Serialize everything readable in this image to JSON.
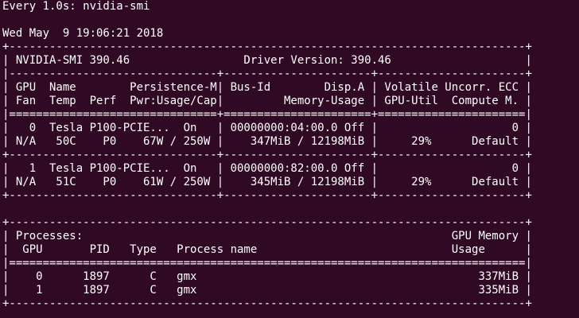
{
  "watch": {
    "header": "Every 1.0s: nvidia-smi",
    "timestamp": "Wed May  9 19:06:21 2018"
  },
  "smi": {
    "lines": [
      "+-----------------------------------------------------------------------------+",
      "| NVIDIA-SMI 390.46                 Driver Version: 390.46                    |",
      "|-------------------------------+----------------------+----------------------+",
      "| GPU  Name        Persistence-M| Bus-Id        Disp.A | Volatile Uncorr. ECC |",
      "| Fan  Temp  Perf  Pwr:Usage/Cap|         Memory-Usage | GPU-Util  Compute M. |",
      "|===============================+======================+======================|",
      "|   0  Tesla P100-PCIE...  On   | 00000000:04:00.0 Off |                    0 |",
      "| N/A   50C    P0    67W / 250W |    347MiB / 12198MiB |     29%      Default |",
      "+-------------------------------+----------------------+----------------------+",
      "|   1  Tesla P100-PCIE...  On   | 00000000:82:00.0 Off |                    0 |",
      "| N/A   51C    P0    61W / 250W |    345MiB / 12198MiB |     29%      Default |",
      "+-------------------------------+----------------------+----------------------+",
      "",
      "+-----------------------------------------------------------------------------+",
      "| Processes:                                                       GPU Memory |",
      "|  GPU       PID   Type   Process name                             Usage      |",
      "|=============================================================================|",
      "|    0      1897      C   gmx                                          337MiB |",
      "|    1      1897      C   gmx                                          335MiB |",
      "+-----------------------------------------------------------------------------+"
    ]
  }
}
